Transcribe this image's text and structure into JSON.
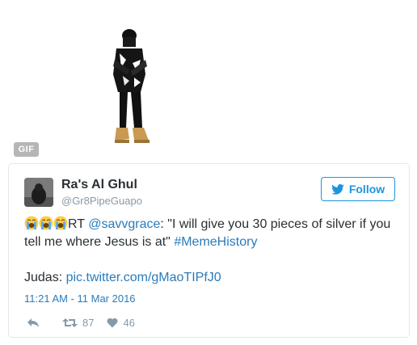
{
  "media": {
    "badge": "GIF"
  },
  "tweet": {
    "author_name": "Ra's Al Ghul",
    "author_handle": "@Gr8PipeGuapo",
    "follow_label": "Follow",
    "text": {
      "prefix_emoji_icon": "loudly-crying-face-icon",
      "rt": "RT ",
      "mention": "@savvgrace",
      "quote": ": \"I will give you 30 pieces of silver if you tell me where Jesus is at\" ",
      "hashtag": "#MemeHistory",
      "judas_prefix": "Judas: ",
      "pic_link": "pic.twitter.com/gMaoTIPfJ0"
    },
    "timestamp": "11:21 AM - 11 Mar 2016",
    "retweet_count": "87",
    "like_count": "46"
  },
  "colors": {
    "brand_blue": "#1b95e0",
    "link_blue": "#2b7bb9",
    "muted": "#8899a6"
  }
}
